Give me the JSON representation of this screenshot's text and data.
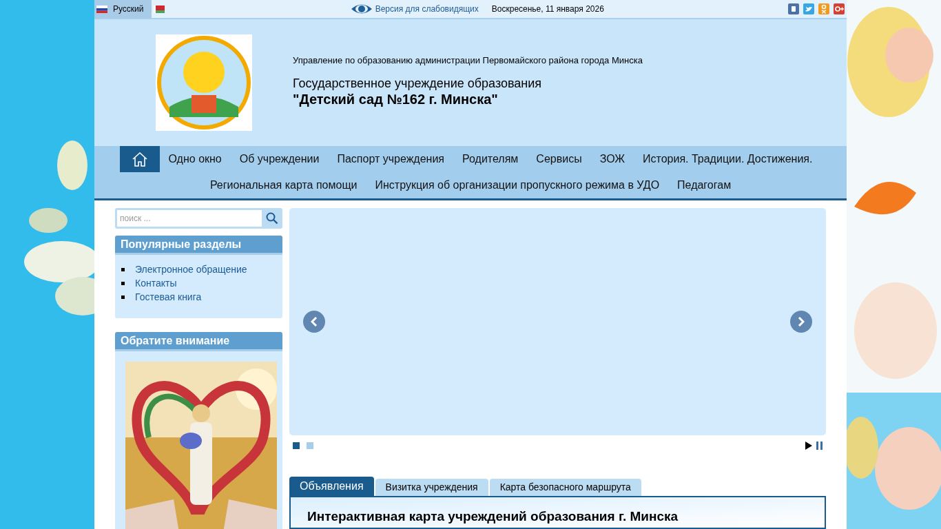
{
  "top_bar": {
    "languages": [
      {
        "label": "Русский",
        "selected": true
      },
      {
        "selected": false
      }
    ],
    "accessibility_link": "Версия для слабовидящих",
    "date": "Воскресенье, 11 января 2026"
  },
  "header": {
    "department": "Управление по образованию администрации Первомайского района города Минска",
    "institution": "Государственное учреждение образования",
    "name": "\"Детский сад №162 г. Минска\""
  },
  "nav": {
    "rows": [
      {
        "items": [
          {
            "kind": "home",
            "selected": true
          },
          {
            "label": "Одно окно",
            "selected": false
          },
          {
            "label": "Об учреждении",
            "selected": false
          },
          {
            "label": "Паспорт учреждения",
            "selected": false
          },
          {
            "label": "Родителям",
            "selected": false
          },
          {
            "label": "Сервисы",
            "selected": false
          },
          {
            "label": "ЗОЖ",
            "selected": false
          },
          {
            "label": "История. Традиции. Достижения.",
            "selected": false
          }
        ]
      },
      {
        "items": [
          {
            "label": "Региональная карта помощи",
            "selected": false
          },
          {
            "label": "Инструкция об организации пропускного режима в УДО",
            "selected": false
          },
          {
            "label": "Педагогам",
            "selected": false
          }
        ]
      }
    ]
  },
  "sidebar": {
    "search": {
      "placeholder": "поиск ..."
    },
    "modules": [
      {
        "title": "Популярные разделы",
        "links": [
          "Электронное обращение",
          "Контакты",
          "Гостевая книга"
        ]
      },
      {
        "title": "Обратите внимание",
        "kind": "picture"
      }
    ]
  },
  "slider": {
    "dots": [
      {
        "selected": true
      },
      {
        "selected": false
      }
    ]
  },
  "tabs": [
    {
      "label": "Объявления",
      "selected": true
    },
    {
      "label": "Визитка учреждения",
      "selected": false
    },
    {
      "label": "Карта безопасного маршрута",
      "selected": false
    }
  ],
  "tab_content": {
    "heading": "Интерактивная карта учреждений образования г. Минска"
  }
}
